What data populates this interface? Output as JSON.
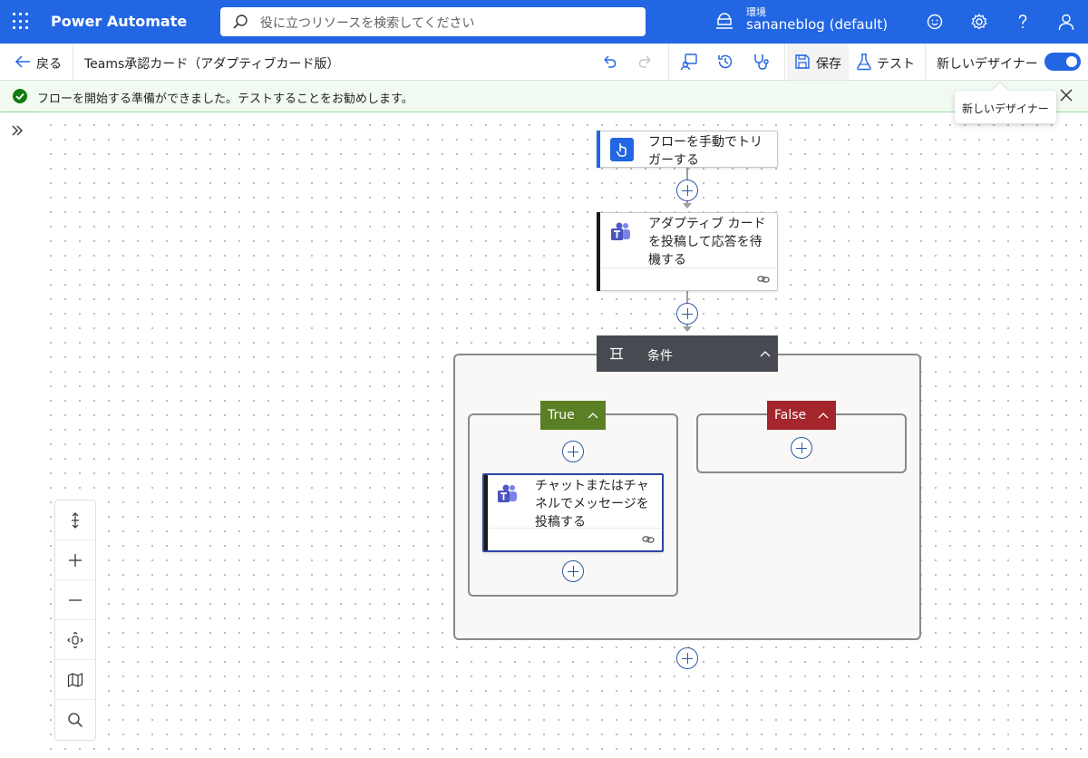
{
  "app": {
    "name": "Power Automate",
    "search_placeholder": "役に立つリソースを検索してください",
    "environment_label": "環境",
    "environment_name": "sananeblog (default)"
  },
  "command_bar": {
    "back_label": "戻る",
    "flow_title": "Teams承認カード（アダプティブカード版）",
    "save_label": "保存",
    "test_label": "テスト",
    "designer_label": "新しいデザイナー",
    "designer_toggle_on": true
  },
  "notification": {
    "text": "フローを開始する準備ができました。テストすることをお勧めします。"
  },
  "tooltip": {
    "text": "新しいデザイナー"
  },
  "flow": {
    "trigger": {
      "title": "フローを手動でトリガーする",
      "icon": "hand-touch-icon"
    },
    "action1": {
      "title": "アダプティブ カードを投稿して応答を待機する",
      "icon": "teams-icon"
    },
    "condition": {
      "label": "条件"
    },
    "true_branch": {
      "label": "True"
    },
    "false_branch": {
      "label": "False"
    },
    "true_action": {
      "title": "チャットまたはチャネルでメッセージを投稿する",
      "icon": "teams-icon"
    }
  },
  "colors": {
    "brand": "#2266e3",
    "condition_header": "#484a52",
    "true_tag": "#5b7f24",
    "false_tag": "#a4262c",
    "success": "#107c10"
  }
}
